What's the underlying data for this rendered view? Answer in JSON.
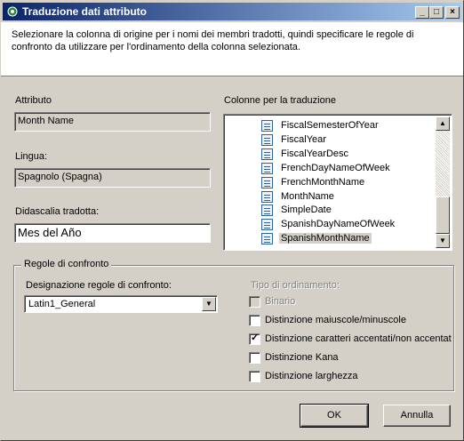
{
  "window": {
    "title": "Traduzione dati attributo",
    "minimize_glyph": "_",
    "maximize_glyph": "□",
    "close_glyph": "×"
  },
  "header": {
    "description": "Selezionare la colonna di origine per i nomi dei membri tradotti, quindi specificare le regole di confronto da utilizzare per l'ordinamento della colonna selezionata."
  },
  "attribute": {
    "label": "Attributo",
    "value": "Month Name"
  },
  "language": {
    "label": "Lingua:",
    "value": "Spagnolo (Spagna)"
  },
  "caption": {
    "label": "Didascalia tradotta:",
    "value": "Mes del Año"
  },
  "columns": {
    "label": "Colonne per la traduzione",
    "items": [
      {
        "label": "FiscalSemesterOfYear",
        "selected": false
      },
      {
        "label": "FiscalYear",
        "selected": false
      },
      {
        "label": "FiscalYearDesc",
        "selected": false
      },
      {
        "label": "FrenchDayNameOfWeek",
        "selected": false
      },
      {
        "label": "FrenchMonthName",
        "selected": false
      },
      {
        "label": "MonthName",
        "selected": false
      },
      {
        "label": "SimpleDate",
        "selected": false
      },
      {
        "label": "SpanishDayNameOfWeek",
        "selected": false
      },
      {
        "label": "SpanishMonthName",
        "selected": true
      }
    ],
    "icon": "table-column-icon"
  },
  "collation": {
    "group_title": "Regole di confronto",
    "designator_label": "Designazione regole di confronto:",
    "designator_value": "Latin1_General",
    "sort_label": "Tipo di ordinamento:",
    "options": [
      {
        "label": "Binario",
        "checked": false,
        "disabled": true
      },
      {
        "label": "Distinzione maiuscole/minuscole",
        "checked": false,
        "disabled": false
      },
      {
        "label": "Distinzione caratteri accentati/non accentat",
        "checked": true,
        "disabled": false
      },
      {
        "label": "Distinzione Kana",
        "checked": false,
        "disabled": false
      },
      {
        "label": "Distinzione larghezza",
        "checked": false,
        "disabled": false
      }
    ]
  },
  "buttons": {
    "ok": "OK",
    "cancel": "Annulla"
  },
  "colors": {
    "title_start": "#0a246a",
    "title_end": "#a6caf0",
    "face": "#d4d0c8"
  }
}
